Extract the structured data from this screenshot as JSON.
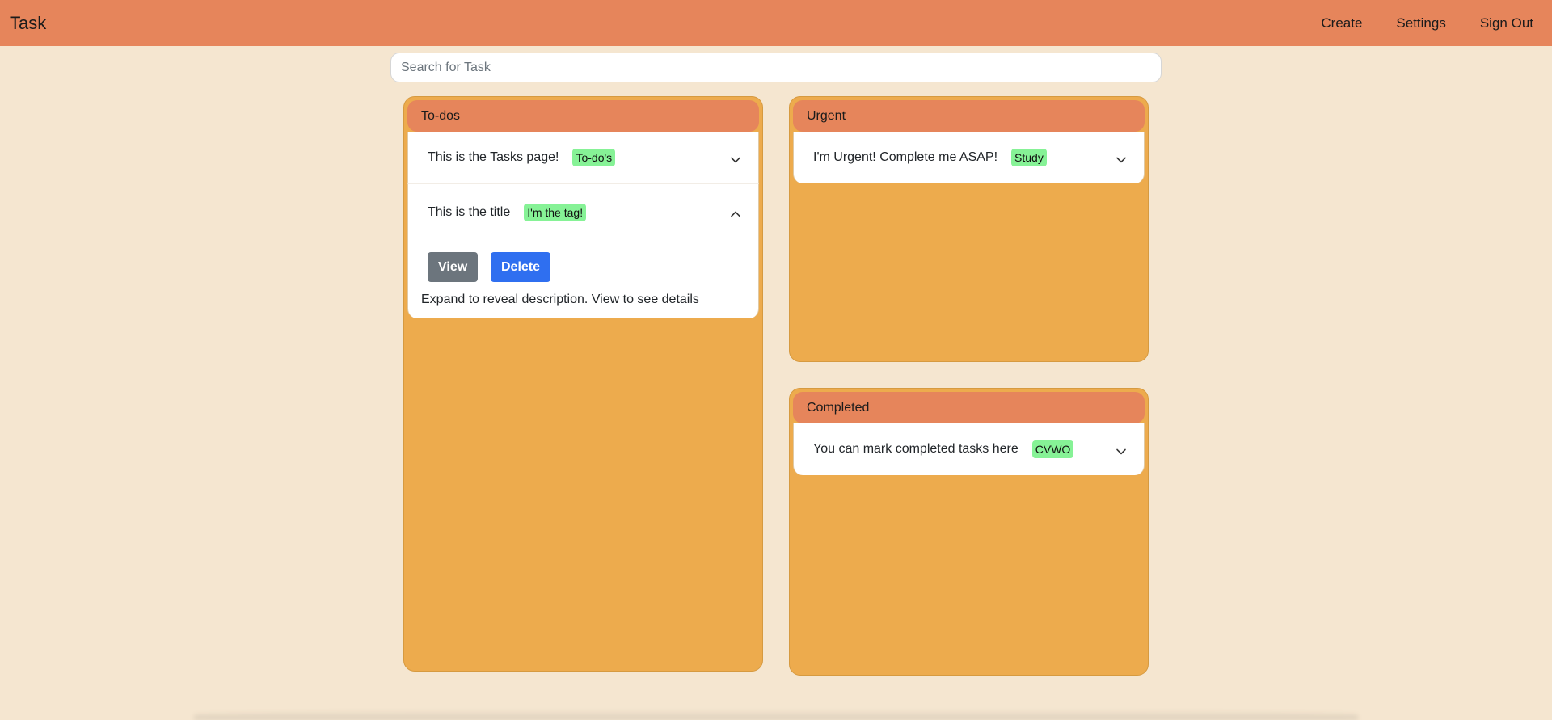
{
  "navbar": {
    "brand": "Task",
    "links": [
      "Create",
      "Settings",
      "Sign Out"
    ]
  },
  "search": {
    "placeholder": "Search for Task",
    "value": ""
  },
  "columns": {
    "todos": {
      "title": "To-dos",
      "cards": [
        {
          "title": "This is the Tasks page!",
          "tag": "To-do's",
          "expanded": false,
          "icon": "chevron-down-icon"
        },
        {
          "title": "This is the title",
          "tag": "I'm the tag!",
          "expanded": true,
          "icon": "chevron-up-icon",
          "view_label": "View",
          "delete_label": "Delete",
          "description": "Expand to reveal description. View to see details"
        }
      ]
    },
    "urgent": {
      "title": "Urgent",
      "cards": [
        {
          "title": "I'm Urgent! Complete me ASAP!",
          "tag": "Study",
          "expanded": false,
          "icon": "chevron-down-icon"
        }
      ]
    },
    "completed": {
      "title": "Completed",
      "cards": [
        {
          "title": "You can mark completed tasks here",
          "tag": "CVWO",
          "expanded": false,
          "icon": "chevron-down-icon"
        }
      ]
    }
  },
  "colors": {
    "navbar": "#e6855b",
    "background": "#f5e6d0",
    "column": "#edab4d",
    "column_header": "#e6855b",
    "tag": "#86f296",
    "view_button": "#6c757d",
    "delete_button": "#2f6ff0"
  }
}
